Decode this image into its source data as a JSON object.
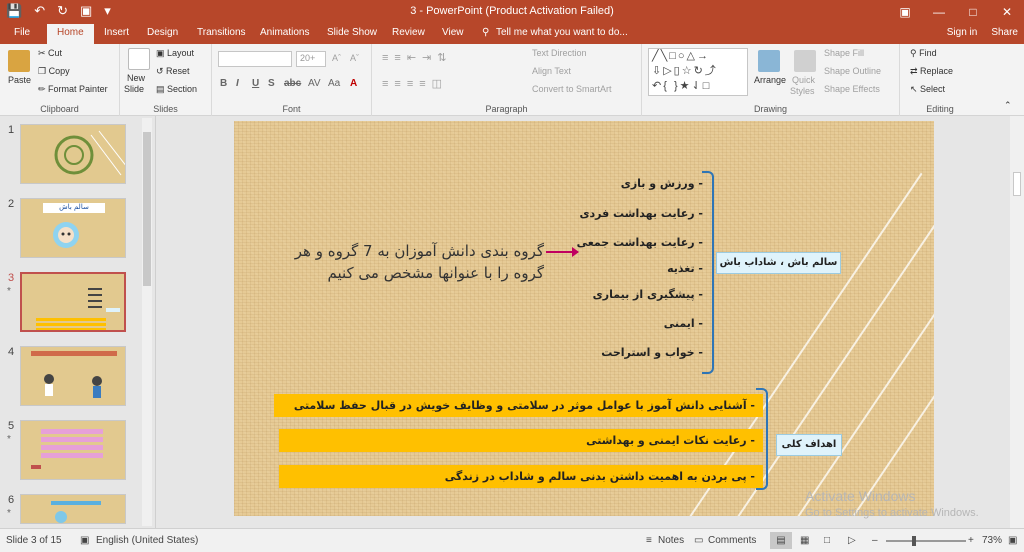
{
  "window": {
    "title": "3 - PowerPoint (Product Activation Failed)"
  },
  "tabs": [
    "File",
    "Home",
    "Insert",
    "Design",
    "Transitions",
    "Animations",
    "Slide Show",
    "Review",
    "View"
  ],
  "tell_me": "Tell me what you want to do...",
  "account": {
    "sign_in": "Sign in",
    "share": "Share"
  },
  "ribbon": {
    "clipboard": {
      "paste": "Paste",
      "cut": "Cut",
      "copy": "Copy",
      "format_painter": "Format Painter",
      "label": "Clipboard"
    },
    "slides": {
      "new_slide": "New",
      "new_slide2": "Slide",
      "layout": "Layout",
      "reset": "Reset",
      "section": "Section",
      "label": "Slides"
    },
    "font": {
      "size": "20+",
      "label": "Font"
    },
    "paragraph": {
      "text_direction": "Text Direction",
      "align_text": "Align Text",
      "convert": "Convert to SmartArt",
      "label": "Paragraph"
    },
    "drawing": {
      "arrange": "Arrange",
      "quick": "Quick",
      "styles": "Styles",
      "shape_fill": "Shape Fill",
      "shape_outline": "Shape Outline",
      "shape_effects": "Shape Effects",
      "label": "Drawing"
    },
    "editing": {
      "find": "Find",
      "replace": "Replace",
      "select": "Select",
      "label": "Editing"
    }
  },
  "thumbnails": [
    {
      "num": "1",
      "star": ""
    },
    {
      "num": "2",
      "star": "",
      "caption": "سالم باش"
    },
    {
      "num": "3",
      "star": "*"
    },
    {
      "num": "4",
      "star": ""
    },
    {
      "num": "5",
      "star": "*"
    },
    {
      "num": "6",
      "star": "*"
    }
  ],
  "slide": {
    "bullets": [
      "- ورزش و بازی",
      "- رعایت بهداشت فردی",
      "- رعایت بهداشت جمعی",
      "- تغذیه",
      "- پیشگیری از بیماری",
      "- ایمنی",
      "- خواب و استراحت"
    ],
    "group_label": "سالم باش ، شاداب باش",
    "instruction": "گروه بندی دانش آموزان به 7 گروه و هر گروه را با عنوانها مشخص می کنیم",
    "goals": [
      "- آشنایی دانش آموز با عوامل موثر در سلامتی و وظایف خویش در قبال حفظ سلامتی",
      "- رعایت نکات ایمنی و بهداشتی",
      "- پی بردن به اهمیت داشتن بدنی سالم و شاداب در زندگی"
    ],
    "goals_label": "اهداف کلی"
  },
  "watermark": {
    "line1": "Activate Windows",
    "line2": "Go to Settings to activate Windows."
  },
  "status": {
    "slide_info": "Slide 3 of 15",
    "language": "English (United States)",
    "notes": "Notes",
    "comments": "Comments",
    "zoom": "73%"
  },
  "colors": {
    "accent": "#b7472a",
    "goal_fill": "#ffc000",
    "bracket": "#2e75b6",
    "arrow": "#c00060"
  }
}
